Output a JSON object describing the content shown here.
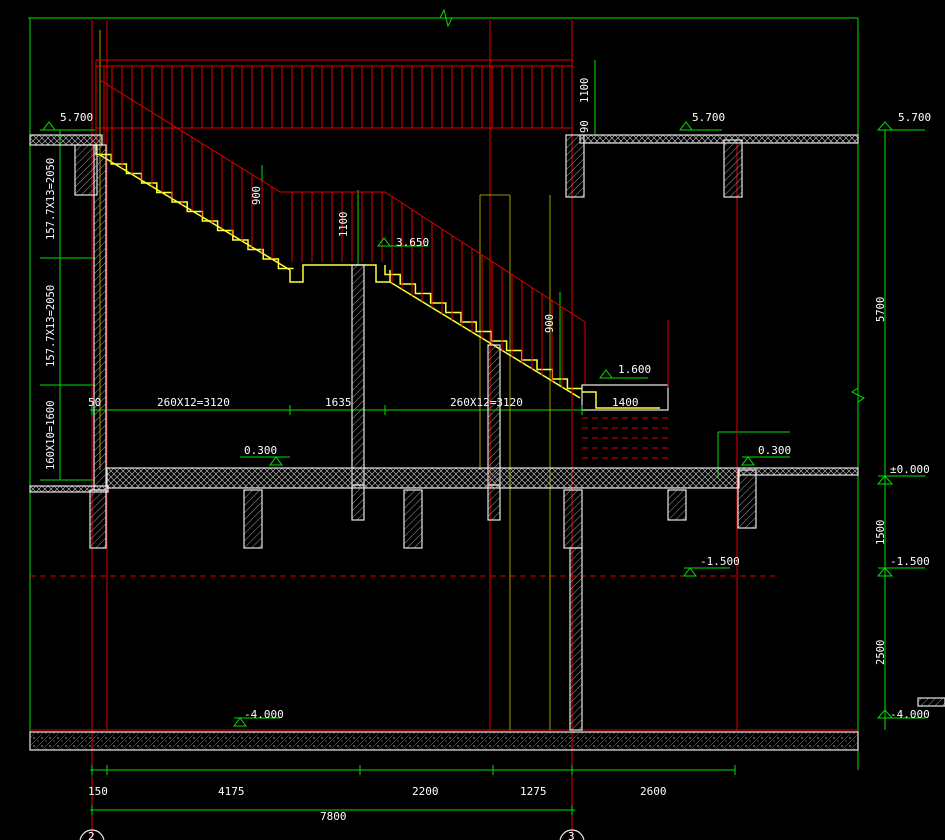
{
  "drawing": {
    "levels": {
      "top_left": "5.700",
      "top_mid": "5.700",
      "top_right": "5.700",
      "landing_mid": "3.650",
      "landing_low": "1.600",
      "floor_left": "0.300",
      "floor_right": "0.300",
      "zero": "±0.000",
      "basement_mid": "-1.500",
      "basement_right": "-1.500",
      "bottom_mid": "-4.000",
      "bottom_right": "-4.000"
    },
    "vertical_dims_left": [
      "157.7X13=2050",
      "157.7X13=2050",
      "160X10=1600"
    ],
    "vertical_dims_right": [
      "5700",
      "1500",
      "2500"
    ],
    "rail_heights": [
      "1100",
      "900",
      "1100",
      "900",
      "90"
    ],
    "horizontal_dims_mid": [
      "50",
      "260X12=3120",
      "1635",
      "260X12=3120",
      "1400"
    ],
    "bottom_dims": [
      "150",
      "4175",
      "2200",
      "1275",
      "2600"
    ],
    "bottom_total": "7800",
    "axis_bubbles": [
      "2",
      "3"
    ]
  },
  "colors": {
    "background": "#000000",
    "dimension": "#00e000",
    "axis": "#e00000",
    "stair_outline": "#ffff33",
    "structure": "#e6e6e6"
  }
}
